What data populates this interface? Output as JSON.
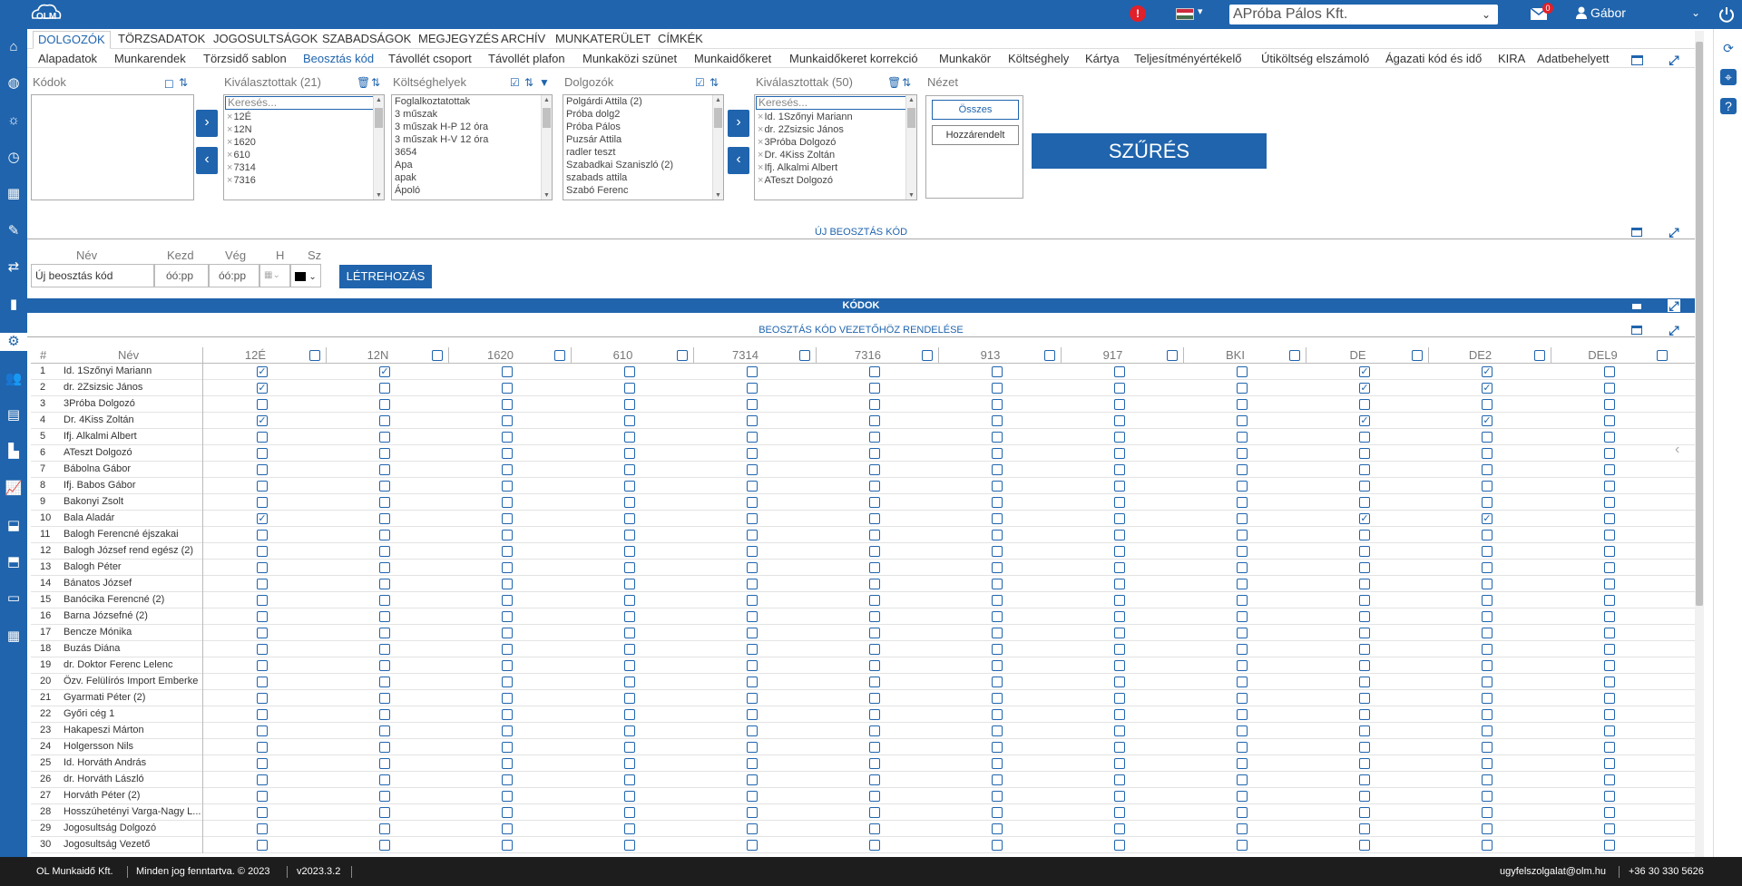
{
  "header": {
    "logo_text": "OLM",
    "alert_symbol": "!",
    "company_select": "APróba Pálos Kft.",
    "mail_count": "0",
    "user_name": "Gábor",
    "colors": {
      "primary": "#1f64ad",
      "alert": "#e0202a",
      "footer": "#1d1d1d"
    }
  },
  "sidebar_icons": [
    "home-icon",
    "globe-icon",
    "sun-icon",
    "clock-icon",
    "calendar-icon",
    "tools-icon",
    "exchange-icon",
    "bar-chart-icon",
    "gears-icon",
    "users-icon",
    "id-card-icon",
    "factory-icon",
    "line-chart-icon",
    "box-in-icon",
    "box-out-icon",
    "folder-icon",
    "calendar-grid-icon"
  ],
  "right_icons": [
    "refresh-icon",
    "crosshair-icon",
    "help-icon"
  ],
  "main_tabs": [
    "DOLGOZÓK",
    "TÖRZSADATOK",
    "JOGOSULTSÁGOK",
    "SZABADSÁGOK",
    "MEGJEGYZÉS",
    "ARCHÍV",
    "MUNKATERÜLET",
    "CÍMKÉK"
  ],
  "sub_tabs": [
    "Alapadatok",
    "Munkarendek",
    "Törzsidő sablon",
    "Beosztás kód",
    "Távollét csoport",
    "Távollét plafon",
    "Munkaközi szünet",
    "Munkaidőkeret",
    "Munkaidőkeret korrekció",
    "Munkakör",
    "Költséghely",
    "Kártya",
    "Teljesítményértékelő",
    "Útiköltség elszámoló",
    "Ágazati kód és idő",
    "KIRA",
    "Adatbehelyett"
  ],
  "filter": {
    "codes_label": "Kódok",
    "selected_codes_label": "Kiválasztottak (21)",
    "search_placeholder": "Keresés...",
    "selected_codes": [
      "12É",
      "12N",
      "1620",
      "610",
      "7314",
      "7316"
    ],
    "cost_centers_label": "Költséghelyek",
    "cost_centers": [
      "Foglalkoztatottak",
      "3 műszak",
      "3 műszak H-P 12 óra",
      "3 műszak H-V 12 óra",
      "3654",
      "Apa",
      "apak",
      "Ápoló"
    ],
    "employees_label": "Dolgozók",
    "employees": [
      "Polgárdi Attila (2)",
      "Próba dolg2",
      "Próba Pálos",
      "Puzsár Attila",
      "radler teszt",
      "Szabadkai Szaniszló (2)",
      "szabads attila",
      "Szabó Ferenc"
    ],
    "selected_employees_label": "Kiválasztottak (50)",
    "selected_employees": [
      "Id. 1Szőnyi Mariann",
      "dr. 2Zsizsic János",
      "3Próba Dolgozó",
      "Dr. 4Kiss Zoltán",
      "Ifj. Alkalmi Albert",
      "ATeszt Dolgozó"
    ],
    "view_label": "Nézet",
    "view_all": "Összes",
    "view_assigned": "Hozzárendelt",
    "filter_button": "SZŰRÉS"
  },
  "new_code": {
    "section_title": "ÚJ BEOSZTÁS KÓD",
    "col_name": "Név",
    "col_start": "Kezd",
    "col_end": "Vég",
    "col_h": "H",
    "col_sz": "Sz",
    "name_value": "Új beosztás kód",
    "start_placeholder": "óó:pp",
    "end_placeholder": "óó:pp",
    "create_button": "LÉTREHOZÁS",
    "color_value": "#000000"
  },
  "codes_section_title": "KÓDOK",
  "assign_section_title": "BEOSZTÁS KÓD VEZETŐHÖZ RENDELÉSE",
  "grid": {
    "col_num": "#",
    "col_name": "Név",
    "codes": [
      "12É",
      "12N",
      "1620",
      "610",
      "7314",
      "7316",
      "913",
      "917",
      "BKI",
      "DE",
      "DE2",
      "DEL9"
    ],
    "rows": [
      {
        "n": "1",
        "name": "Id. 1Szőnyi Mariann",
        "checked": [
          0,
          1,
          9,
          10
        ]
      },
      {
        "n": "2",
        "name": "dr. 2Zsizsic János",
        "checked": [
          0,
          9,
          10
        ]
      },
      {
        "n": "3",
        "name": "3Próba Dolgozó",
        "checked": []
      },
      {
        "n": "4",
        "name": "Dr. 4Kiss Zoltán",
        "checked": [
          0,
          9,
          10
        ]
      },
      {
        "n": "5",
        "name": "Ifj. Alkalmi Albert",
        "checked": []
      },
      {
        "n": "6",
        "name": "ATeszt Dolgozó",
        "checked": []
      },
      {
        "n": "7",
        "name": "Bábolna Gábor",
        "checked": []
      },
      {
        "n": "8",
        "name": "Ifj. Babos Gábor",
        "checked": []
      },
      {
        "n": "9",
        "name": "Bakonyi Zsolt",
        "checked": []
      },
      {
        "n": "10",
        "name": "Bala Aladár",
        "checked": [
          0,
          9,
          10
        ]
      },
      {
        "n": "11",
        "name": "Balogh Ferencné éjszakai",
        "checked": []
      },
      {
        "n": "12",
        "name": "Balogh József rend egész (2)",
        "checked": []
      },
      {
        "n": "13",
        "name": "Balogh Péter",
        "checked": []
      },
      {
        "n": "14",
        "name": "Bánatos József",
        "checked": []
      },
      {
        "n": "15",
        "name": "Banócika Ferencné (2)",
        "checked": []
      },
      {
        "n": "16",
        "name": "Barna Józsefné (2)",
        "checked": []
      },
      {
        "n": "17",
        "name": "Bencze Mónika",
        "checked": []
      },
      {
        "n": "18",
        "name": "Buzás Diána",
        "checked": []
      },
      {
        "n": "19",
        "name": "dr. Doktor Ferenc Lelenc",
        "checked": []
      },
      {
        "n": "20",
        "name": "Özv. Felülírós Import Emberke",
        "checked": []
      },
      {
        "n": "21",
        "name": "Gyarmati Péter (2)",
        "checked": []
      },
      {
        "n": "22",
        "name": "Győri cég 1",
        "checked": []
      },
      {
        "n": "23",
        "name": "Hakapeszi Márton",
        "checked": []
      },
      {
        "n": "24",
        "name": "Holgersson Nils",
        "checked": []
      },
      {
        "n": "25",
        "name": "Id. Horváth András",
        "checked": []
      },
      {
        "n": "26",
        "name": "dr. Horváth László",
        "checked": []
      },
      {
        "n": "27",
        "name": "Horváth Péter (2)",
        "checked": []
      },
      {
        "n": "28",
        "name": "Hosszúhetényi Varga-Nagy L...",
        "checked": []
      },
      {
        "n": "29",
        "name": "Jogosultság Dolgozó",
        "checked": []
      },
      {
        "n": "30",
        "name": "Jogosultság Vezető",
        "checked": []
      }
    ]
  },
  "footer": {
    "company": "OL Munkaidő Kft.",
    "rights": "Minden jog fenntartva. © 2023",
    "version": "v2023.3.2",
    "email": "ugyfelszolgalat@olm.hu",
    "phone": "+36 30 330 5626"
  }
}
